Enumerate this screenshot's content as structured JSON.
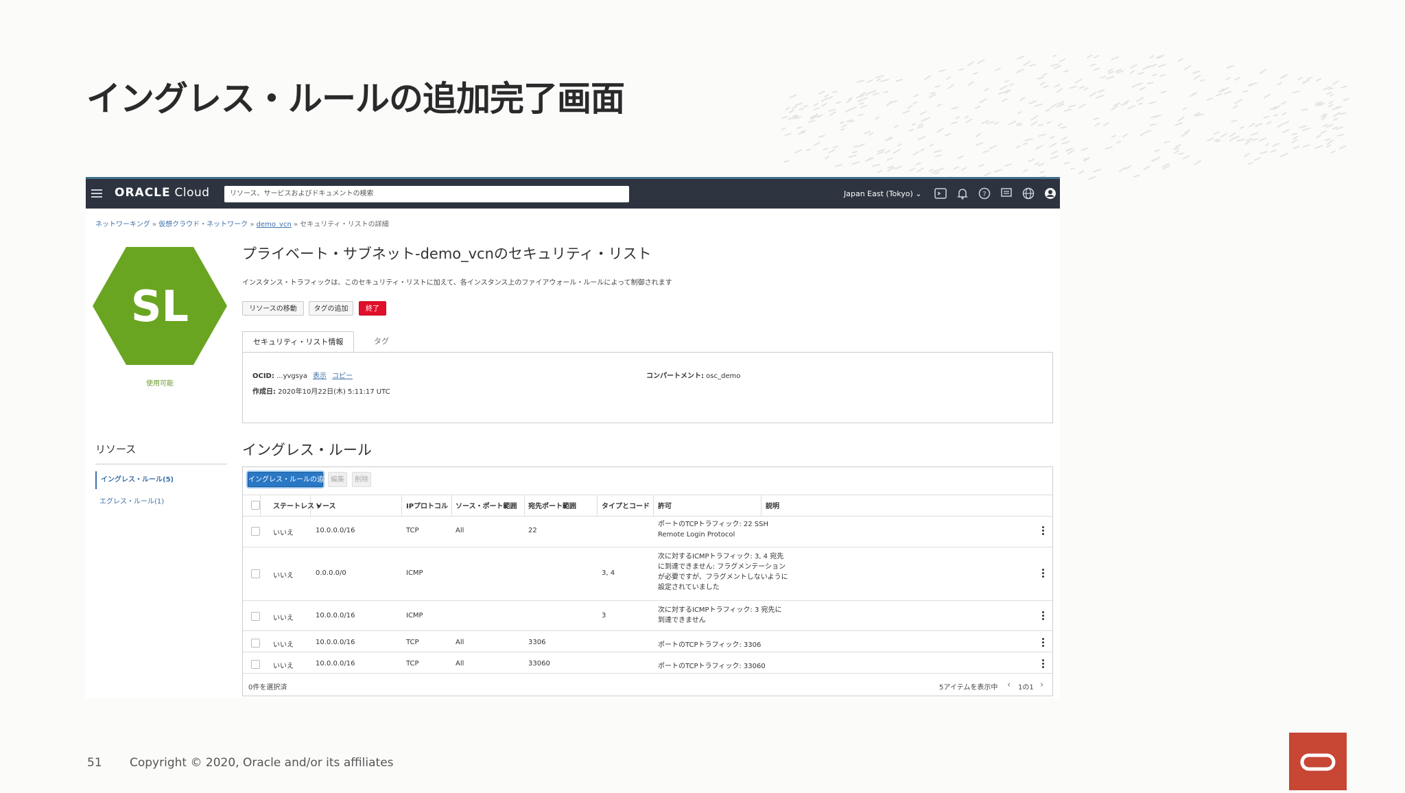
{
  "slide": {
    "title": "イングレス・ルールの追加完了画面",
    "page_number": "51",
    "copyright": "Copyright © 2020, Oracle and/or its affiliates",
    "brand_color": "#c74634"
  },
  "console": {
    "brand_main": "ORACLE",
    "brand_sub": " Cloud",
    "search_placeholder": "リソース、サービスおよびドキュメントの検索",
    "region": "Japan East (Tokyo)",
    "icons": [
      "cloud-shell-icon",
      "bell-icon",
      "help-icon",
      "chat-icon",
      "globe-icon",
      "user-icon"
    ],
    "breadcrumb": [
      "ネットワーキング",
      "仮想クラウド・ネットワーク",
      "demo_vcn",
      "セキュリティ・リストの詳細"
    ],
    "breadcrumb_sep": " » ",
    "hex_label": "SL",
    "hex_color": "#6aa522",
    "status": "使用可能",
    "heading": "プライベート・サブネット-demo_vcnのセキュリティ・リスト",
    "description": "インスタンス・トラフィックは、このセキュリティ・リストに加えて、各インスタンス上のファイアウォール・ルールによって制御されます",
    "buttons": {
      "move": "リソースの移動",
      "tag": "タグの追加",
      "terminate": "終了"
    },
    "tabs": [
      "セキュリティ・リスト情報",
      "タグ"
    ],
    "info": {
      "ocid_label": "OCID:",
      "ocid_value": " ...yvgsya",
      "show": "表示",
      "copy": "コピー",
      "created_label": "作成日:",
      "created_value": " 2020年10月22日(木) 5:11:17 UTC",
      "compartment_label": "コンパートメント:",
      "compartment_value": " osc_demo"
    },
    "resources": {
      "title": "リソース",
      "items": [
        "イングレス・ルール(5)",
        "エグレス・ルール(1)"
      ]
    },
    "rules": {
      "title": "イングレス・ルール",
      "add_button": "イングレス・ルールの追加",
      "edit_button": "編集",
      "delete_button": "削除",
      "columns": [
        "ステートレス ▾",
        "ソース",
        "IPプロトコル",
        "ソース・ポート範囲",
        "宛先ポート範囲",
        "タイプとコード",
        "許可",
        "説明"
      ],
      "rows": [
        {
          "stateless": "いいえ",
          "source": "10.0.0.0/16",
          "protocol": "TCP",
          "src_port": "All",
          "dst_port": "22",
          "type_code": "",
          "allows": "ポートのTCPトラフィック: 22 SSH Remote Login Protocol",
          "desc": ""
        },
        {
          "stateless": "いいえ",
          "source": "0.0.0.0/0",
          "protocol": "ICMP",
          "src_port": "",
          "dst_port": "",
          "type_code": "3, 4",
          "allows": "次に対するICMPトラフィック: 3, 4 宛先に到達できません: フラグメンテーションが必要ですが、フラグメントしないように設定されていました",
          "desc": ""
        },
        {
          "stateless": "いいえ",
          "source": "10.0.0.0/16",
          "protocol": "ICMP",
          "src_port": "",
          "dst_port": "",
          "type_code": "3",
          "allows": "次に対するICMPトラフィック: 3 宛先に到達できません",
          "desc": ""
        },
        {
          "stateless": "いいえ",
          "source": "10.0.0.0/16",
          "protocol": "TCP",
          "src_port": "All",
          "dst_port": "3306",
          "type_code": "",
          "allows": "ポートのTCPトラフィック: 3306",
          "desc": ""
        },
        {
          "stateless": "いいえ",
          "source": "10.0.0.0/16",
          "protocol": "TCP",
          "src_port": "All",
          "dst_port": "33060",
          "type_code": "",
          "allows": "ポートのTCPトラフィック: 33060",
          "desc": ""
        }
      ],
      "selected": "0件を選択済",
      "showing": "5アイテムを表示中",
      "page": "1の1"
    }
  }
}
